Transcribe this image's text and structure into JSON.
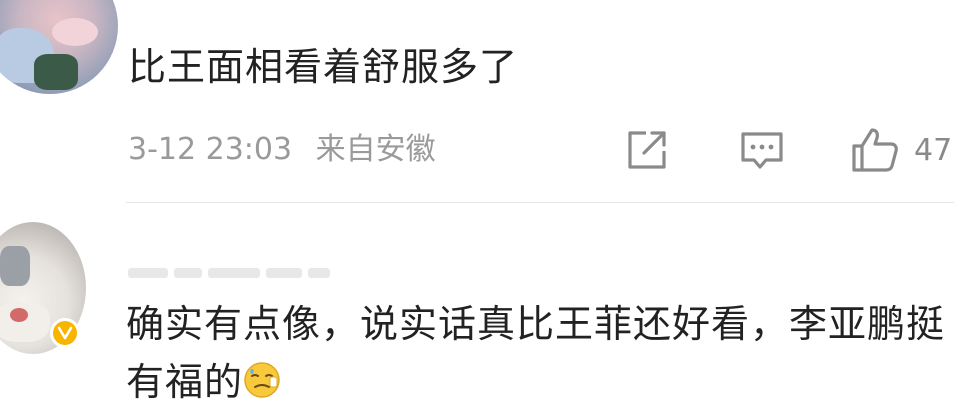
{
  "comments": [
    {
      "text": "比王面相看着舒服多了",
      "time": "3-12 23:03",
      "location": "来自安徽",
      "likes": "47",
      "avatar": "user-avatar-photo-pink-flowers"
    },
    {
      "text": "确实有点像，说实话真比王菲还好看，李亚鹏挺有福的",
      "emoji": "sweat-smile-emoji",
      "verified": true,
      "avatar": "user-avatar-photo-doll"
    }
  ],
  "icons": {
    "share": "share-icon",
    "reply": "comment-icon",
    "like": "thumbs-up-icon",
    "badge": "verified-v-badge"
  },
  "colors": {
    "text": "#222222",
    "meta": "#9a9a9a",
    "icon": "#8a8a8a",
    "divider": "#e6e6e6",
    "verified": "#f7b500"
  }
}
